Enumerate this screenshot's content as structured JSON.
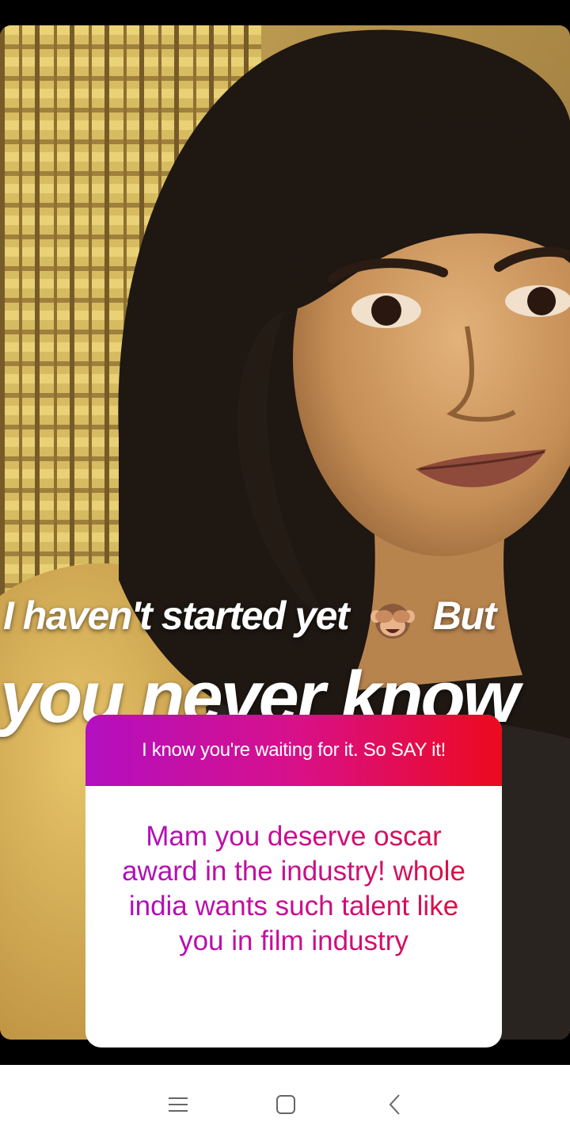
{
  "story": {
    "caption_line1_a": "I haven't started yet",
    "caption_line1_b": "But",
    "caption_line2": "you never know",
    "emoji": "see-no-evil-monkey-icon"
  },
  "question_sticker": {
    "prompt": "I know you're waiting for it. So SAY it!",
    "answer": "Mam you deserve oscar award  in the industry! whole india wants such talent like you in film industry",
    "gradient_start": "#b30fc1",
    "gradient_end": "#ec0a1e"
  },
  "nav_bar": {
    "menu_icon": "menu-icon",
    "home_icon": "home-square-icon",
    "back_icon": "back-chevron-icon"
  }
}
